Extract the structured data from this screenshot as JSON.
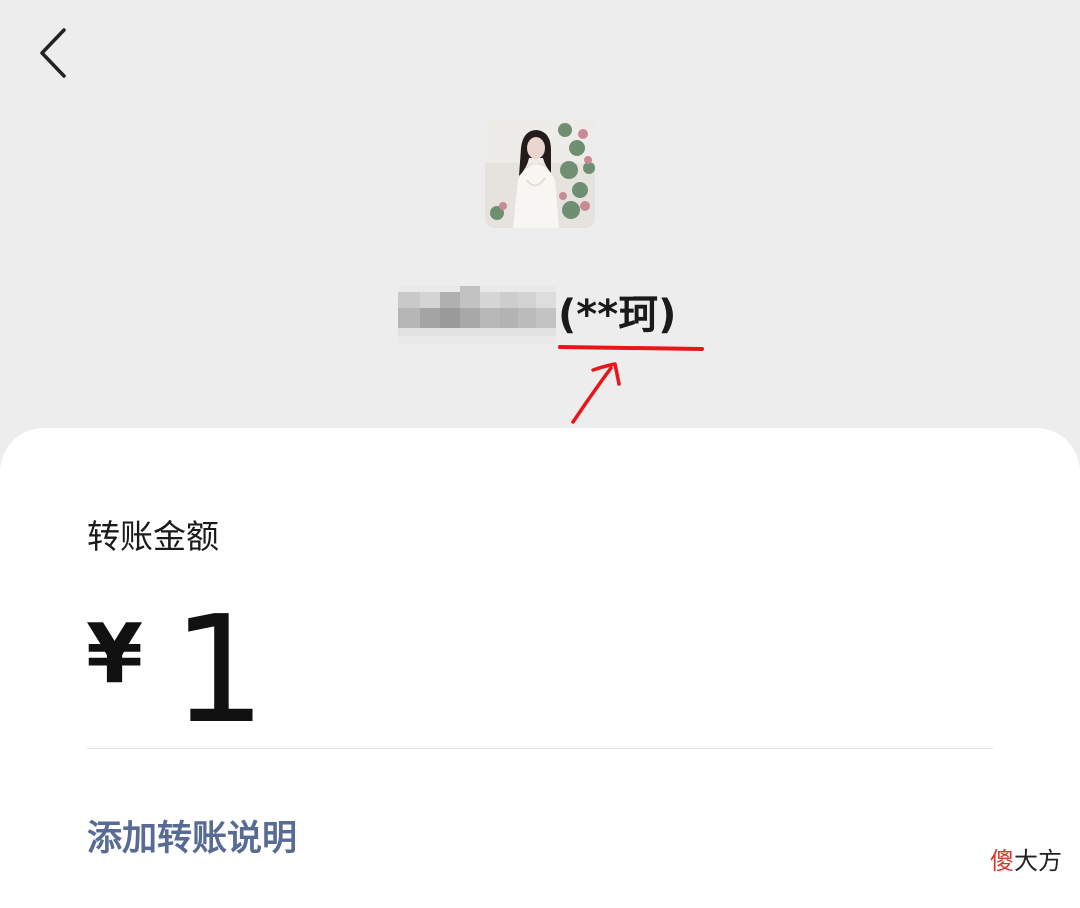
{
  "payee": {
    "masked_name_suffix": "(**珂)"
  },
  "transfer": {
    "amount_label": "转账金额",
    "currency_symbol": "¥",
    "amount": "1",
    "add_note_label": "添加转账说明"
  },
  "watermark": {
    "red_char": "傻",
    "rest": "大方"
  },
  "icons": {
    "back": "back-chevron-icon"
  },
  "colors": {
    "page_background": "#ededed",
    "card_background": "#ffffff",
    "link": "#576b95",
    "annotation": "#e8161a",
    "watermark_accent": "#d9362b"
  }
}
